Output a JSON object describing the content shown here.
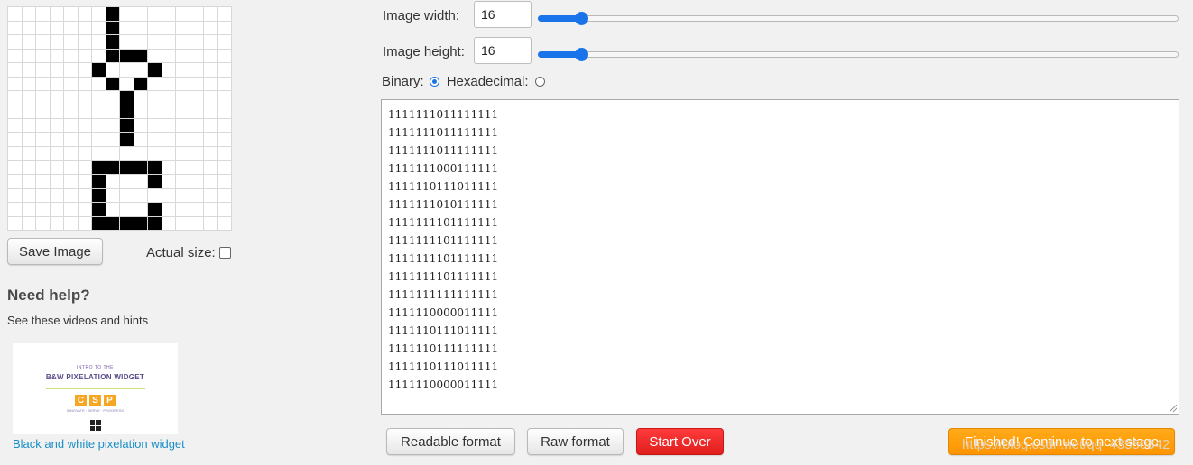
{
  "pixel_grid": {
    "size": 16,
    "rows": [
      "1111111011111111",
      "1111111011111111",
      "1111111011111111",
      "1111111000111111",
      "1111110111011111",
      "1111111010111111",
      "1111111101111111",
      "1111111101111111",
      "1111111101111111",
      "1111111101111111",
      "1111111111111111",
      "1111110000011111",
      "1111110111011111",
      "1111110111111111",
      "1111110111011111",
      "1111110000011111"
    ]
  },
  "left_panel": {
    "save_label": "Save Image",
    "actual_size_label": "Actual size:",
    "help_title": "Need help?",
    "help_subtitle": "See these videos and hints",
    "thumbnail": {
      "pretitle": "INTRO TO THE",
      "title": "B&W PIXELATION WIDGET",
      "logo_letters": [
        "C",
        "S",
        "P"
      ],
      "tagline": "INNOVATE · SERVE · PROGRESS"
    },
    "thumbnail_link": "Black and white pixelation widget"
  },
  "controls": {
    "width_label": "Image width:",
    "width_value": "16",
    "width_slider_fraction": 0.068,
    "height_label": "Image height:",
    "height_value": "16",
    "height_slider_fraction": 0.068,
    "binary_label": "Binary:",
    "hex_label": "Hexadecimal:",
    "selected_format": "binary"
  },
  "buttons": {
    "readable": "Readable format",
    "raw": "Raw format",
    "start_over": "Start Over",
    "finish": "Finished! Continue to next stage"
  },
  "watermark": "https://blog.csdn.net/qq_43550342",
  "colors": {
    "slider_accent": "#1a73e8",
    "start_over": "#e82424",
    "finish": "#ff9d0a",
    "link": "#1a8fc8"
  }
}
